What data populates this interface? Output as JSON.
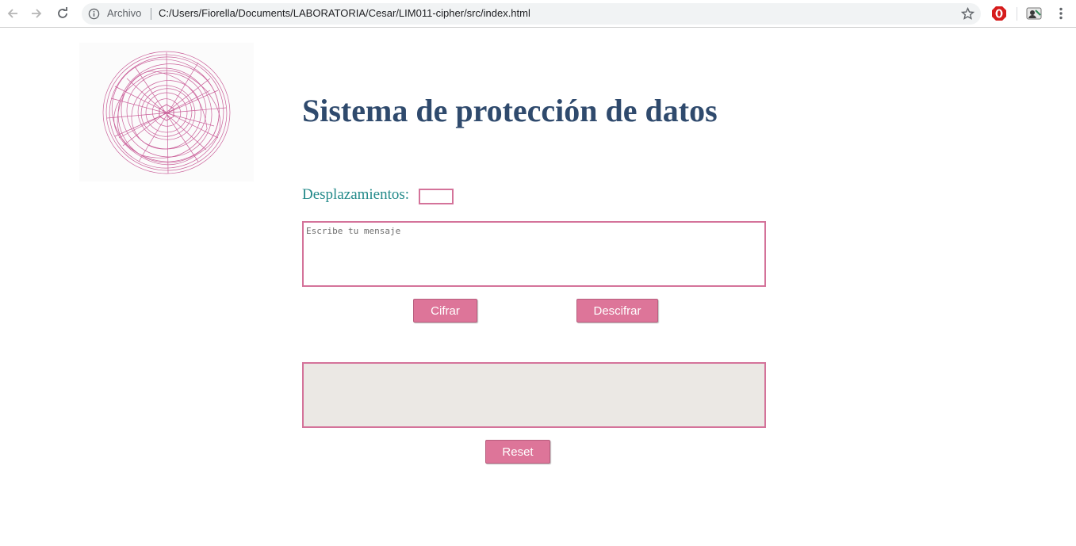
{
  "browser": {
    "scheme_label": "Archivo",
    "url": "C:/Users/Fiorella/Documents/LABORATORIA/Cesar/LIM011-cipher/src/index.html",
    "icons": [
      "back-arrow-icon",
      "forward-arrow-icon",
      "reload-icon",
      "info-icon",
      "star-icon",
      "opera-extension-icon",
      "profile-extension-icon",
      "more-menu-icon"
    ]
  },
  "page": {
    "title": "Sistema de protección de datos",
    "shift": {
      "label": "Desplazamientos:",
      "value": ""
    },
    "message": {
      "placeholder": "Escribe tu mensaje",
      "value": ""
    },
    "buttons": {
      "encrypt": "Cifrar",
      "decrypt": "Descifrar",
      "reset": "Reset"
    },
    "result": {
      "value": ""
    }
  },
  "colors": {
    "title": "#2f4a6d",
    "label": "#238a8a",
    "accent_border": "#d4739a",
    "button_bg": "#dd7599",
    "result_bg": "#ebe8e4"
  }
}
